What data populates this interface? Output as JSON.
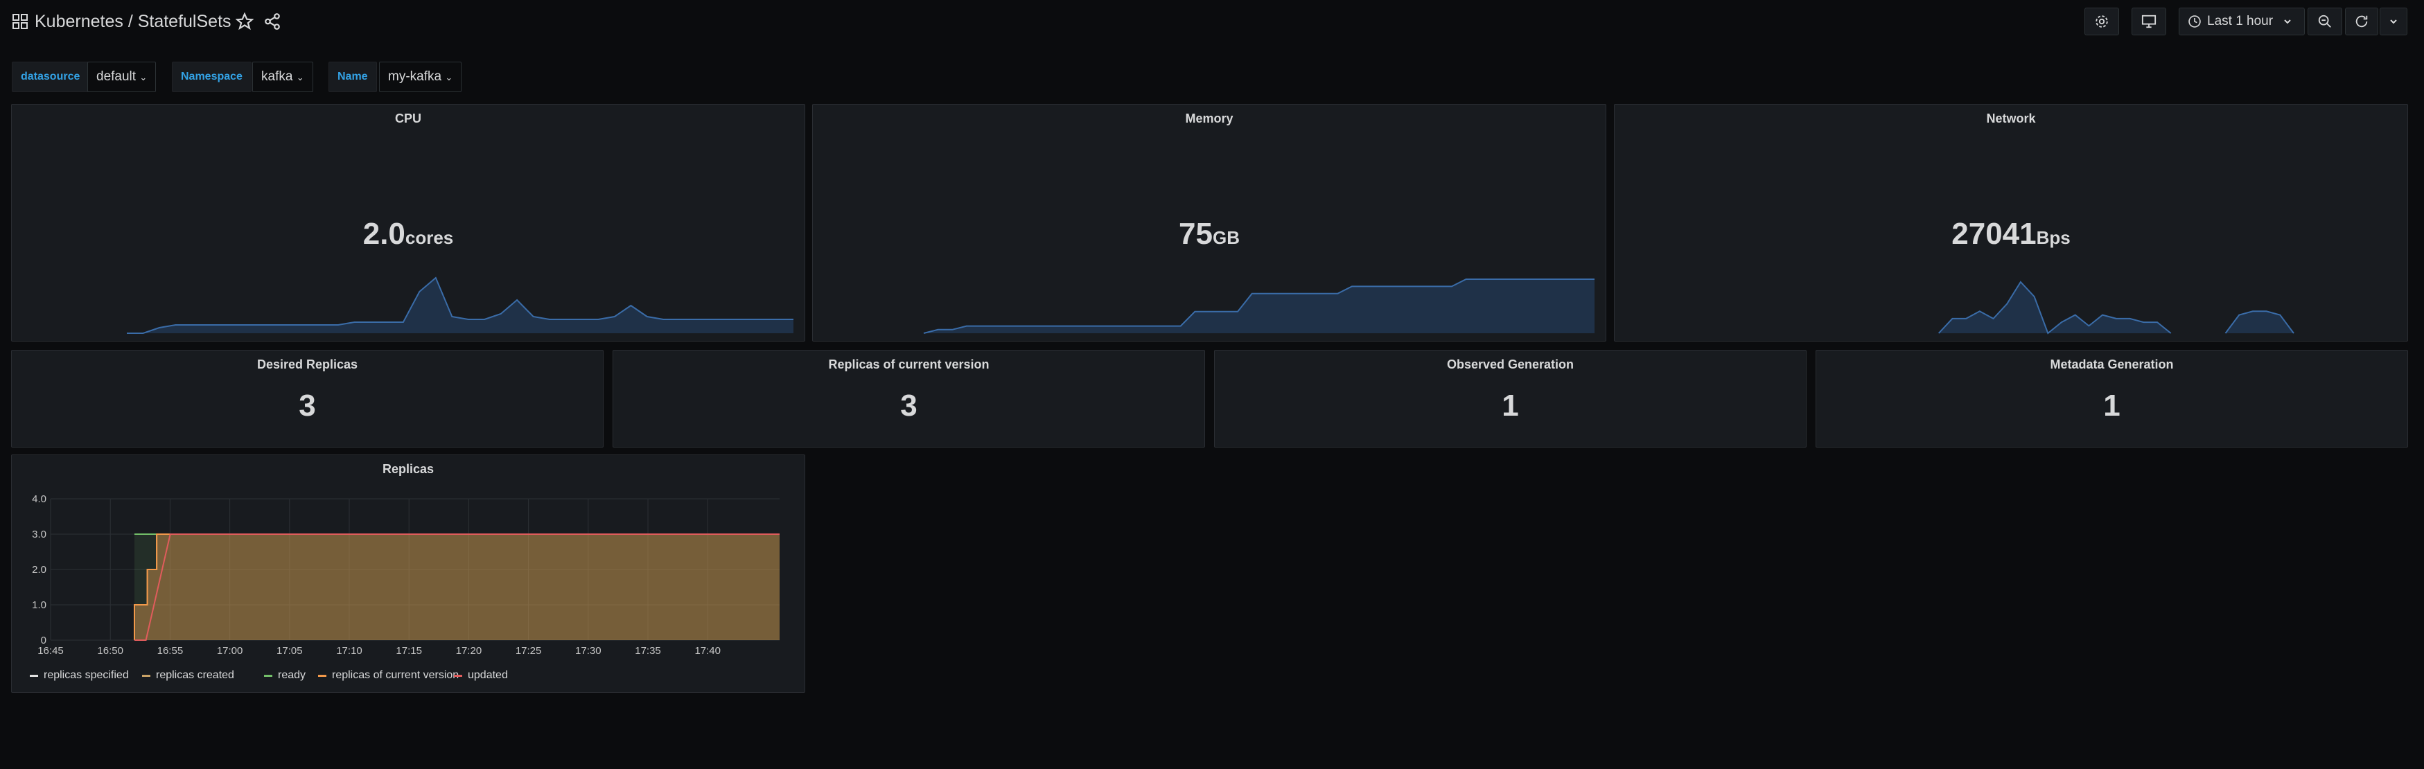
{
  "header": {
    "title": "Kubernetes / StatefulSets",
    "time_range": "Last 1 hour"
  },
  "variables": [
    {
      "label": "datasource",
      "value": "default"
    },
    {
      "label": "Namespace",
      "value": "kafka"
    },
    {
      "label": "Name",
      "value": "my-kafka"
    }
  ],
  "panels": {
    "cpu": {
      "title": "CPU",
      "value": "2.0",
      "unit": "cores",
      "spark": [
        0,
        0,
        2,
        3,
        3,
        3,
        3,
        3,
        3,
        3,
        3,
        3,
        3,
        3,
        4,
        4,
        4,
        4,
        15,
        20,
        6,
        5,
        5,
        7,
        12,
        6,
        5,
        5,
        5,
        5,
        6,
        10,
        6,
        5,
        5,
        5,
        5,
        5,
        5,
        5,
        5,
        5
      ]
    },
    "memory": {
      "title": "Memory",
      "value": "75",
      "unit": "GB",
      "spark": [
        0,
        1,
        1,
        2,
        2,
        2,
        2,
        2,
        2,
        2,
        2,
        2,
        2,
        2,
        2,
        2,
        2,
        2,
        2,
        6,
        6,
        6,
        6,
        11,
        11,
        11,
        11,
        11,
        11,
        11,
        13,
        13,
        13,
        13,
        13,
        13,
        13,
        13,
        15,
        15,
        15,
        15,
        15,
        15,
        15,
        15,
        15,
        15
      ]
    },
    "network": {
      "title": "Network",
      "value": "27041",
      "unit": "Bps",
      "spark": [
        null,
        0,
        4,
        4,
        6,
        4,
        8,
        14,
        10,
        0,
        3,
        5,
        2,
        5,
        4,
        4,
        3,
        3,
        0,
        null,
        null,
        null,
        0,
        5,
        6,
        6,
        5,
        0
      ]
    },
    "stats": [
      {
        "title": "Desired Replicas",
        "value": "3"
      },
      {
        "title": "Replicas of current version",
        "value": "3"
      },
      {
        "title": "Observed Generation",
        "value": "1"
      },
      {
        "title": "Metadata Generation",
        "value": "1"
      }
    ]
  },
  "chart_data": {
    "type": "line",
    "title": "Replicas",
    "x": [
      "16:45",
      "16:50",
      "16:55",
      "17:00",
      "17:05",
      "17:10",
      "17:15",
      "17:20",
      "17:25",
      "17:30",
      "17:35",
      "17:40"
    ],
    "ylim": [
      0,
      4
    ],
    "yticks": [
      "0",
      "1.0",
      "2.0",
      "3.0",
      "4.0"
    ],
    "grid": true,
    "legend_position": "bottom-left",
    "series": [
      {
        "name": "replicas specified",
        "color": "#e0e0e0",
        "points": [
          [
            16.867,
            3
          ],
          [
            16.917,
            3
          ],
          [
            17.767,
            3
          ]
        ]
      },
      {
        "name": "replicas created",
        "color": "#c8a266",
        "points": [
          [
            16.867,
            0
          ],
          [
            16.867,
            1
          ],
          [
            16.885,
            1
          ],
          [
            16.885,
            2
          ],
          [
            16.898,
            2
          ],
          [
            16.898,
            3
          ],
          [
            17.767,
            3
          ]
        ]
      },
      {
        "name": "ready",
        "color": "#73bf69",
        "points": [
          [
            16.867,
            3
          ],
          [
            16.917,
            3
          ],
          [
            17.767,
            3
          ]
        ]
      },
      {
        "name": "replicas of current version",
        "color": "#f2994a",
        "points": [
          [
            16.867,
            0
          ],
          [
            16.867,
            1
          ],
          [
            16.885,
            1
          ],
          [
            16.885,
            2
          ],
          [
            16.898,
            2
          ],
          [
            16.898,
            3
          ],
          [
            17.767,
            3
          ]
        ]
      },
      {
        "name": "updated",
        "color": "#e05c5c",
        "points": [
          [
            16.867,
            0
          ],
          [
            16.883,
            0
          ],
          [
            16.917,
            3
          ],
          [
            17.767,
            3
          ]
        ]
      }
    ]
  }
}
